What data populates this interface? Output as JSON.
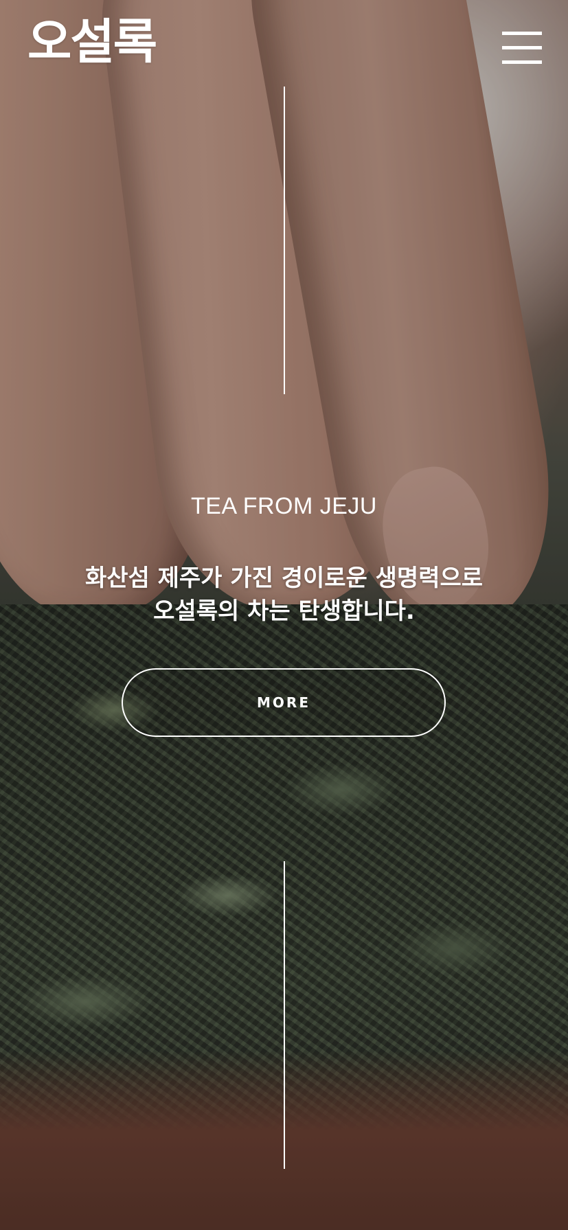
{
  "header": {
    "logo_text": "오설록",
    "menu_icon": "hamburger-menu-icon"
  },
  "hero": {
    "background": "tea-leaves-video-still",
    "eyebrow": "TEA FROM JEJU",
    "headline_line1": "화산섬 제주가 가진 경이로운 생명력으로",
    "headline_line2": "오설록의 차는 탄생합니다.",
    "more_label": "MORE"
  },
  "colors": {
    "text": "#ffffff",
    "line": "#ffffff"
  }
}
